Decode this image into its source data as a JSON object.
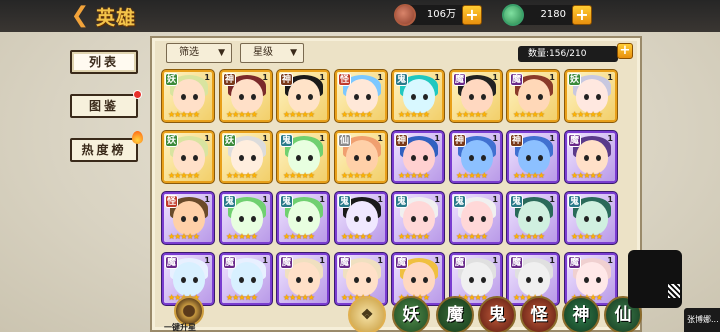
{
  "header": {
    "title": "英雄",
    "coins": "106万",
    "jade": "2180"
  },
  "tabs": [
    {
      "label": "列表",
      "active": true
    },
    {
      "label": "图鉴",
      "badge": "red-dot"
    },
    {
      "label": "热度榜",
      "badge": "flame"
    }
  ],
  "filters": {
    "filter_label": "筛选",
    "star_label": "星级"
  },
  "count_label": "数量:156/210",
  "heroes": [
    {
      "tag": "妖",
      "lv": "1",
      "frame": "gold",
      "hair": "#d8e4a0",
      "skin": "#ffe0c8"
    },
    {
      "tag": "神",
      "lv": "1",
      "frame": "gold",
      "hair": "#7a2a2a",
      "skin": "#ffe0c8"
    },
    {
      "tag": "神",
      "lv": "1",
      "frame": "gold",
      "hair": "#1a1a1a",
      "skin": "#ffe3c8"
    },
    {
      "tag": "怪",
      "lv": "1",
      "frame": "gold",
      "hair": "#7cc8ff",
      "skin": "#ffe8d8"
    },
    {
      "tag": "鬼",
      "lv": "1",
      "frame": "gold",
      "hair": "#20c8c0",
      "skin": "#d8f8ff"
    },
    {
      "tag": "魔",
      "lv": "1",
      "frame": "gold",
      "hair": "#222222",
      "skin": "#ffd8c0"
    },
    {
      "tag": "魔",
      "lv": "1",
      "frame": "gold",
      "hair": "#8a3a2a",
      "skin": "#ffd8b8"
    },
    {
      "tag": "妖",
      "lv": "1",
      "frame": "gold",
      "hair": "#c8c8e0",
      "skin": "#ffe8e0"
    },
    {
      "tag": "妖",
      "lv": "1",
      "frame": "gold",
      "hair": "#d8e4a0",
      "skin": "#ffe0c8"
    },
    {
      "tag": "妖",
      "lv": "1",
      "frame": "gold",
      "hair": "#dcdcdc",
      "skin": "#ffeede"
    },
    {
      "tag": "鬼",
      "lv": "1",
      "frame": "gold",
      "hair": "#70d070",
      "skin": "#e8ffe0"
    },
    {
      "tag": "仙",
      "lv": "1",
      "frame": "gold",
      "hair": "#f0a070",
      "skin": "#ffd0a8"
    },
    {
      "tag": "神",
      "lv": "1",
      "frame": "purple",
      "hair": "#3060c0",
      "skin": "#ffd0d0"
    },
    {
      "tag": "神",
      "lv": "1",
      "frame": "purple",
      "hair": "#4070d0",
      "skin": "#8cc0ff"
    },
    {
      "tag": "神",
      "lv": "1",
      "frame": "purple",
      "hair": "#4070d0",
      "skin": "#8cc0ff"
    },
    {
      "tag": "魔",
      "lv": "1",
      "frame": "purple",
      "hair": "#5a3a8a",
      "skin": "#ffe0c8"
    },
    {
      "tag": "怪",
      "lv": "1",
      "frame": "purple",
      "hair": "#6a4a2a",
      "skin": "#ffd0a8"
    },
    {
      "tag": "鬼",
      "lv": "1",
      "frame": "purple",
      "hair": "#70d070",
      "skin": "#e8ffe0"
    },
    {
      "tag": "鬼",
      "lv": "1",
      "frame": "purple",
      "hair": "#70d070",
      "skin": "#e8ffe0"
    },
    {
      "tag": "鬼",
      "lv": "1",
      "frame": "purple",
      "hair": "#1a1a1a",
      "skin": "#f0e8ff"
    },
    {
      "tag": "鬼",
      "lv": "1",
      "frame": "purple",
      "hair": "#f0f0f0",
      "skin": "#ffd8d8"
    },
    {
      "tag": "鬼",
      "lv": "1",
      "frame": "purple",
      "hair": "#f0f0f0",
      "skin": "#ffd8d8"
    },
    {
      "tag": "鬼",
      "lv": "1",
      "frame": "purple",
      "hair": "#2a6a5a",
      "skin": "#d0f0e0"
    },
    {
      "tag": "鬼",
      "lv": "1",
      "frame": "purple",
      "hair": "#2a6a5a",
      "skin": "#d0f0e0"
    },
    {
      "tag": "魔",
      "lv": "1",
      "frame": "purple",
      "hair": "#e8f0ff",
      "skin": "#d8f0ff"
    },
    {
      "tag": "魔",
      "lv": "1",
      "frame": "purple",
      "hair": "#e8f0ff",
      "skin": "#d8f0ff"
    },
    {
      "tag": "魔",
      "lv": "1",
      "frame": "purple",
      "hair": "#f0e0c0",
      "skin": "#ffe0c8"
    },
    {
      "tag": "魔",
      "lv": "1",
      "frame": "purple",
      "hair": "#f0e0c0",
      "skin": "#ffe0c8"
    },
    {
      "tag": "魔",
      "lv": "1",
      "frame": "purple",
      "hair": "#f0c040",
      "skin": "#ffd8c0"
    },
    {
      "tag": "魔",
      "lv": "1",
      "frame": "purple",
      "hair": "#e0e0e0",
      "skin": "#f0f0f0"
    },
    {
      "tag": "魔",
      "lv": "1",
      "frame": "purple",
      "hair": "#e0e0e0",
      "skin": "#f0f0f0"
    },
    {
      "tag": "魔",
      "lv": "1",
      "frame": "purple",
      "hair": "#f0d0d0",
      "skin": "#ffe8e8"
    }
  ],
  "tag_colors": {
    "妖": "#3a8a3a",
    "神": "#7a3a1a",
    "怪": "#c03a2a",
    "鬼": "#2a7a8a",
    "魔": "#6a2a8a",
    "仙": "#8a8a8a"
  },
  "bottom": {
    "upgrade_label": "一键升星",
    "faction_buttons": [
      "",
      "妖",
      "魔",
      "鬼",
      "怪",
      "神",
      "仙"
    ]
  },
  "overlay": {
    "viewer_name": "张博娜..."
  }
}
